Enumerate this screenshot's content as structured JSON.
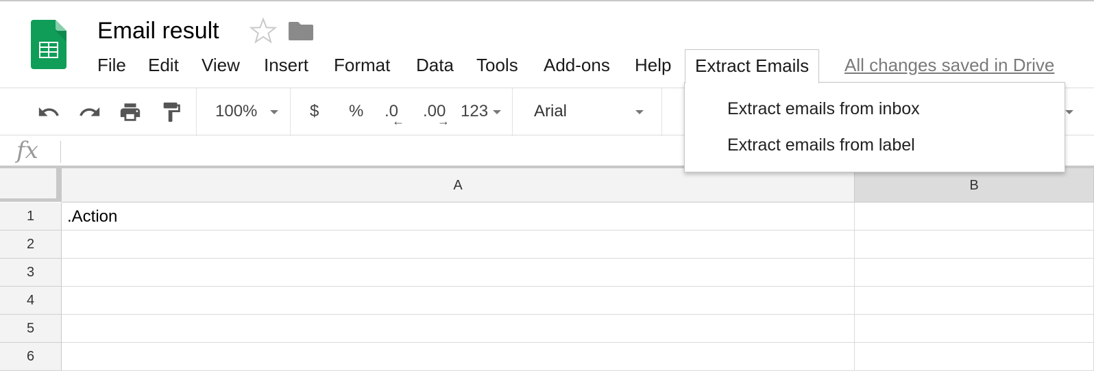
{
  "document": {
    "title": "Email result"
  },
  "menubar": {
    "items": [
      "File",
      "Edit",
      "View",
      "Insert",
      "Format",
      "Data",
      "Tools",
      "Add-ons",
      "Help",
      "Extract Emails"
    ],
    "status": "All changes saved in Drive"
  },
  "toolbar": {
    "zoom": "100%",
    "currency": "$",
    "percent": "%",
    "decrease_decimal": ".0",
    "increase_decimal": ".00",
    "more_formats": "123",
    "font": "Arial"
  },
  "formula_bar": {
    "fx_label": "fx",
    "value": ""
  },
  "grid": {
    "columns": [
      "A",
      "B"
    ],
    "rows": [
      "1",
      "2",
      "3",
      "4",
      "5",
      "6"
    ],
    "cells": {
      "A1": ".Action"
    }
  },
  "dropdown": {
    "items": [
      "Extract emails from inbox",
      "Extract emails from label"
    ]
  },
  "colors": {
    "sheets_green": "#0f9d58",
    "sheets_dark_green": "#188038",
    "icon_gray": "#8a8a8a"
  }
}
